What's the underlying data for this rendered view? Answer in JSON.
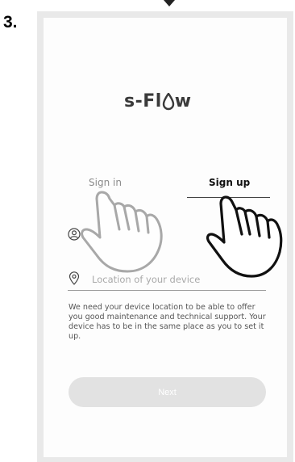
{
  "step_label": "3.",
  "app": {
    "logo_text_left": "s-Fl",
    "logo_text_right": "w"
  },
  "tabs": [
    {
      "label": "Sign in",
      "active": false
    },
    {
      "label": "Sign up",
      "active": true
    }
  ],
  "form": {
    "location_placeholder": "Location of your device",
    "info_text": "We need your device location to be able to offer you good maintenance and technical support. Your device has to be in the same place as you to set it up."
  },
  "next_button": {
    "label": "Next",
    "enabled": false
  },
  "icons": [
    "user-icon",
    "location-pin-icon",
    "pointing-hand-icon"
  ],
  "colors": {
    "accent": "#3a3a3a",
    "disabled_button": "#e2e2e2",
    "frame": "#e9e9e9"
  }
}
